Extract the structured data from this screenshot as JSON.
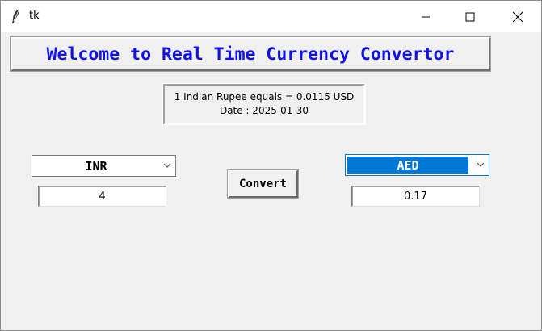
{
  "window": {
    "title": "tk",
    "minimize_icon": "minimize-icon",
    "maximize_icon": "maximize-icon",
    "close_icon": "close-icon"
  },
  "banner": {
    "text": "Welcome to Real Time Currency Convertor",
    "color": "#1010e8"
  },
  "rate_info": {
    "line1": "1 Indian Rupee equals = 0.0115 USD",
    "line2": "Date : 2025-01-30"
  },
  "from_currency": {
    "selected": "INR",
    "amount": "4"
  },
  "to_currency": {
    "selected": "AED",
    "amount": "0.17",
    "highlight_color": "#0078d7"
  },
  "convert_button": {
    "label": "Convert"
  }
}
